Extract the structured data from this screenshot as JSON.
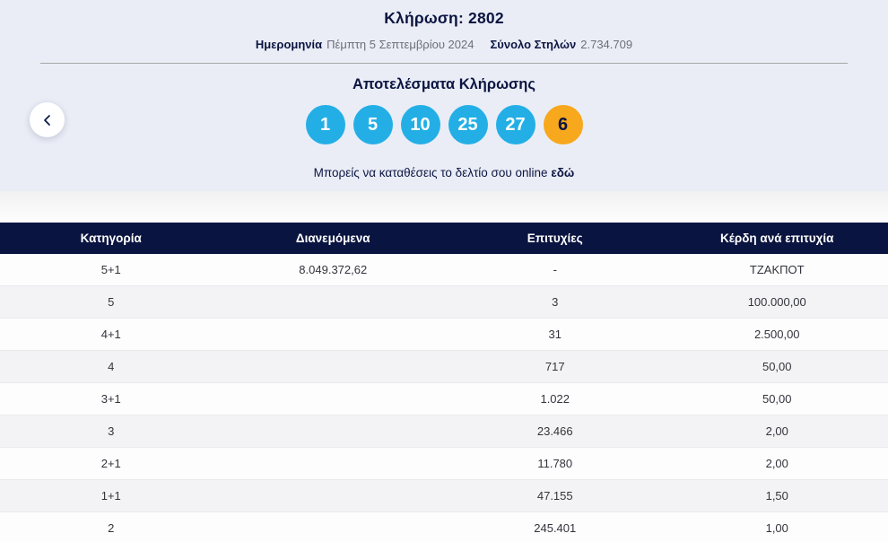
{
  "header": {
    "title": "Κλήρωση: 2802",
    "date_label": "Ημερομηνία",
    "date_value": "Πέμπτη 5 Σεπτεμβρίου 2024",
    "columns_label": "Σύνολο Στηλών",
    "columns_value": "2.734.709",
    "results_heading": "Αποτελέσματα Κλήρωσης",
    "deposit_text": "Μπορείς να καταθέσεις το δελτίο σου online",
    "deposit_link_label": "εδώ"
  },
  "draw": {
    "numbers": [
      "1",
      "5",
      "10",
      "25",
      "27"
    ],
    "bonus": "6"
  },
  "colors": {
    "number_ball": "#23afe6",
    "bonus_ball": "#f8a81c",
    "header_navy": "#0a1440",
    "section_bg": "#eaedf6"
  },
  "icons": {
    "prev": "chevron-left"
  },
  "table": {
    "headers": [
      "Κατηγορία",
      "Διανεμόμενα",
      "Επιτυχίες",
      "Κέρδη ανά επιτυχία"
    ],
    "rows": [
      {
        "category": "5+1",
        "distributed": "8.049.372,62",
        "winners": "-",
        "prize": "ΤΖΑΚΠΟΤ"
      },
      {
        "category": "5",
        "distributed": "",
        "winners": "3",
        "prize": "100.000,00"
      },
      {
        "category": "4+1",
        "distributed": "",
        "winners": "31",
        "prize": "2.500,00"
      },
      {
        "category": "4",
        "distributed": "",
        "winners": "717",
        "prize": "50,00"
      },
      {
        "category": "3+1",
        "distributed": "",
        "winners": "1.022",
        "prize": "50,00"
      },
      {
        "category": "3",
        "distributed": "",
        "winners": "23.466",
        "prize": "2,00"
      },
      {
        "category": "2+1",
        "distributed": "",
        "winners": "11.780",
        "prize": "2,00"
      },
      {
        "category": "1+1",
        "distributed": "",
        "winners": "47.155",
        "prize": "1,50"
      },
      {
        "category": "2",
        "distributed": "",
        "winners": "245.401",
        "prize": "1,00"
      }
    ]
  }
}
